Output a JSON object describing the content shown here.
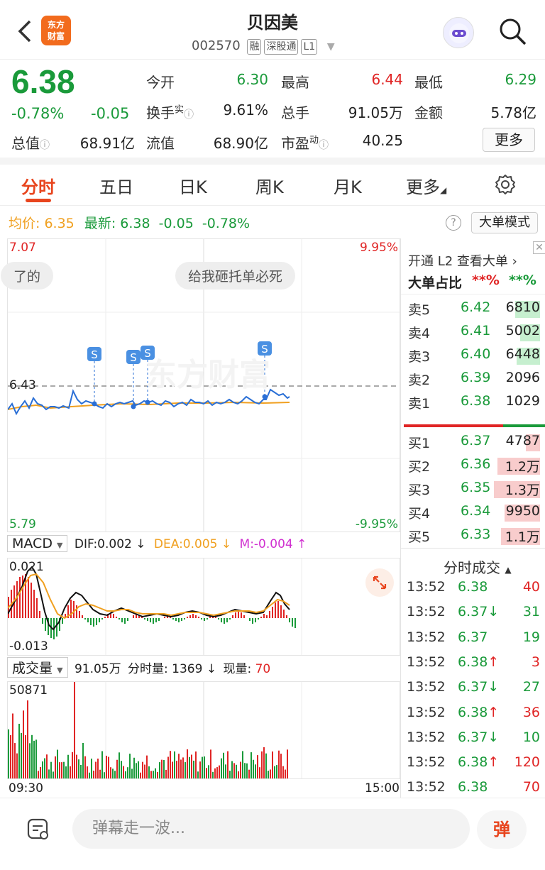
{
  "header": {
    "logo_line1": "东方",
    "logo_line2": "财富",
    "title": "贝因美",
    "code": "002570",
    "tags": [
      "融",
      "深股通",
      "L1"
    ]
  },
  "quote": {
    "price": "6.38",
    "change_pct": "-0.78%",
    "change": "-0.05",
    "total_mv_label": "总值",
    "total_mv": "68.91亿",
    "rows": [
      {
        "label": "今开",
        "value": "6.30",
        "color": "green",
        "label2": "最高",
        "value2": "6.44",
        "color2": "red",
        "label3": "最低",
        "value3": "6.29",
        "color3": "green"
      },
      {
        "label": "换手",
        "sup": "实",
        "value": "9.61%",
        "color": "black",
        "label2": "总手",
        "value2": "91.05万",
        "color2": "black",
        "label3": "金额",
        "value3": "5.78亿",
        "color3": "black"
      },
      {
        "label": "流值",
        "value": "68.90亿",
        "color": "black",
        "label2": "市盈",
        "sup2": "动",
        "value2": "40.25",
        "color2": "black"
      }
    ],
    "more_button": "更多"
  },
  "tabs": [
    "分时",
    "五日",
    "日K",
    "周K",
    "月K",
    "更多"
  ],
  "active_tab": "分时",
  "summary": {
    "avg_label": "均价:",
    "avg_value": "6.35",
    "latest_label": "最新:",
    "latest_value": "6.38",
    "change": "-0.05",
    "change_pct": "-0.78%",
    "mode_button": "大单模式"
  },
  "chart": {
    "y_top": "7.07",
    "y_bottom": "5.79",
    "pct_top": "9.95%",
    "pct_bottom": "-9.95%",
    "ref_price": "6.43",
    "danmu1": "了的",
    "danmu2": "给我砸托单必死",
    "watermark": "东方财富",
    "s_marker": "S",
    "x_start": "09:30",
    "x_end": "15:00"
  },
  "macd": {
    "name": "MACD",
    "dif": "DIF:0.002 ↓",
    "dea": "DEA:0.005 ↓",
    "m": "M:-0.004 ↑",
    "y_top": "0.021",
    "y_bottom": "-0.013"
  },
  "volume": {
    "name": "成交量",
    "total": "91.05万",
    "minute_label": "分时量: 1369 ↓",
    "now_label": "现量:",
    "now_value": "70",
    "y_top": "50871"
  },
  "l2": {
    "banner": "开通 L2 查看大单 ›",
    "ratio_label": "大单占比",
    "ratio_red": "**%",
    "ratio_green": "**%"
  },
  "orderbook": {
    "asks": [
      {
        "label": "卖5",
        "price": "6.42",
        "vol": "6810",
        "bar": 0.35
      },
      {
        "label": "卖4",
        "price": "6.41",
        "vol": "5002",
        "bar": 0.28
      },
      {
        "label": "卖3",
        "price": "6.40",
        "vol": "6448",
        "bar": 0.33
      },
      {
        "label": "卖2",
        "price": "6.39",
        "vol": "2096",
        "bar": 0.0
      },
      {
        "label": "卖1",
        "price": "6.38",
        "vol": "1029",
        "bar": 0.0
      }
    ],
    "bids": [
      {
        "label": "买1",
        "price": "6.37",
        "vol": "4787",
        "bar": 0.2
      },
      {
        "label": "买2",
        "price": "6.36",
        "vol": "1.2万",
        "bar": 0.6
      },
      {
        "label": "买3",
        "price": "6.35",
        "vol": "1.3万",
        "bar": 0.65
      },
      {
        "label": "买4",
        "price": "6.34",
        "vol": "9950",
        "bar": 0.5
      },
      {
        "label": "买5",
        "price": "6.33",
        "vol": "1.1万",
        "bar": 0.55
      }
    ]
  },
  "trades": {
    "title": "分时成交",
    "rows": [
      {
        "time": "13:52",
        "price": "6.38",
        "dir": "",
        "vol": "40",
        "vcolor": "red"
      },
      {
        "time": "13:52",
        "price": "6.37",
        "dir": "↓",
        "vol": "31",
        "vcolor": "green"
      },
      {
        "time": "13:52",
        "price": "6.37",
        "dir": "",
        "vol": "19",
        "vcolor": "green"
      },
      {
        "time": "13:52",
        "price": "6.38",
        "dir": "↑",
        "vol": "3",
        "vcolor": "red"
      },
      {
        "time": "13:52",
        "price": "6.37",
        "dir": "↓",
        "vol": "27",
        "vcolor": "green"
      },
      {
        "time": "13:52",
        "price": "6.38",
        "dir": "↑",
        "vol": "36",
        "vcolor": "red"
      },
      {
        "time": "13:52",
        "price": "6.37",
        "dir": "↓",
        "vol": "10",
        "vcolor": "green"
      },
      {
        "time": "13:52",
        "price": "6.38",
        "dir": "↑",
        "vol": "120",
        "vcolor": "red"
      },
      {
        "time": "13:52",
        "price": "6.38",
        "dir": "",
        "vol": "70",
        "vcolor": "red"
      }
    ]
  },
  "bottom": {
    "placeholder": "弹幕走一波...",
    "danmu_button": "弹"
  }
}
